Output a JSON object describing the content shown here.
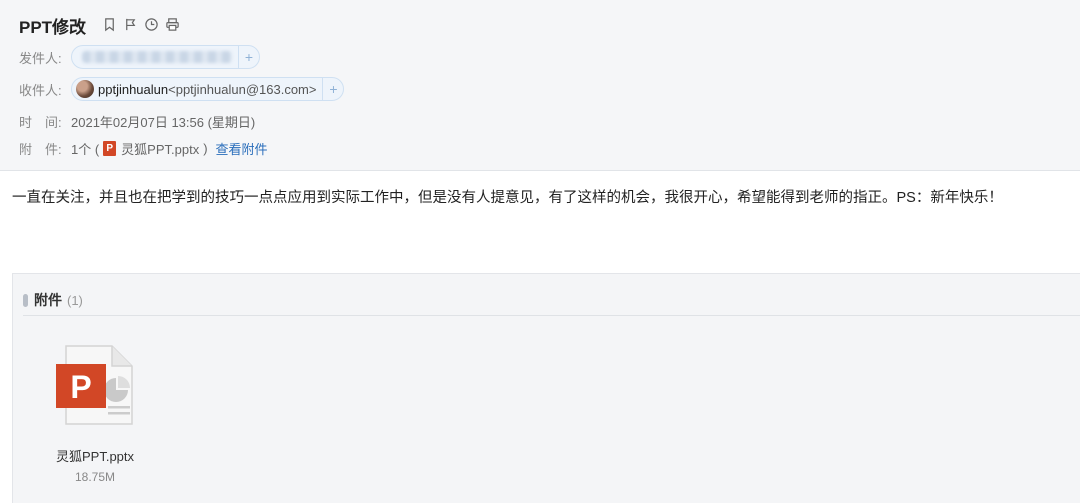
{
  "subject": "PPT修改",
  "header_icons": [
    "bookmark-icon",
    "flag-icon",
    "clock-icon",
    "print-icon"
  ],
  "from": {
    "label": "发件人:"
  },
  "to": {
    "label": "收件人:",
    "name": "pptjinhualun",
    "email": "<pptjinhualun@163.com>"
  },
  "time": {
    "label": "时　间:",
    "value": "2021年02月07日 13:56 (星期日)"
  },
  "attach_line": {
    "label": "附　件:",
    "count": "1个 (",
    "file": "灵狐PPT.pptx",
    "close": ")",
    "view_link": "查看附件"
  },
  "body": "一直在关注，并且也在把学到的技巧一点点应用到实际工作中，但是没有人提意见，有了这样的机会，我很开心，希望能得到老师的指正。PS：新年快乐！",
  "attachments": {
    "title": "附件",
    "count": "(1)",
    "files": [
      {
        "name": "灵狐PPT.pptx",
        "size": "18.75M"
      }
    ]
  },
  "colors": {
    "ppt_red": "#d24726",
    "link_blue": "#2a6ebb",
    "header_bg": "#f5f6f8"
  }
}
